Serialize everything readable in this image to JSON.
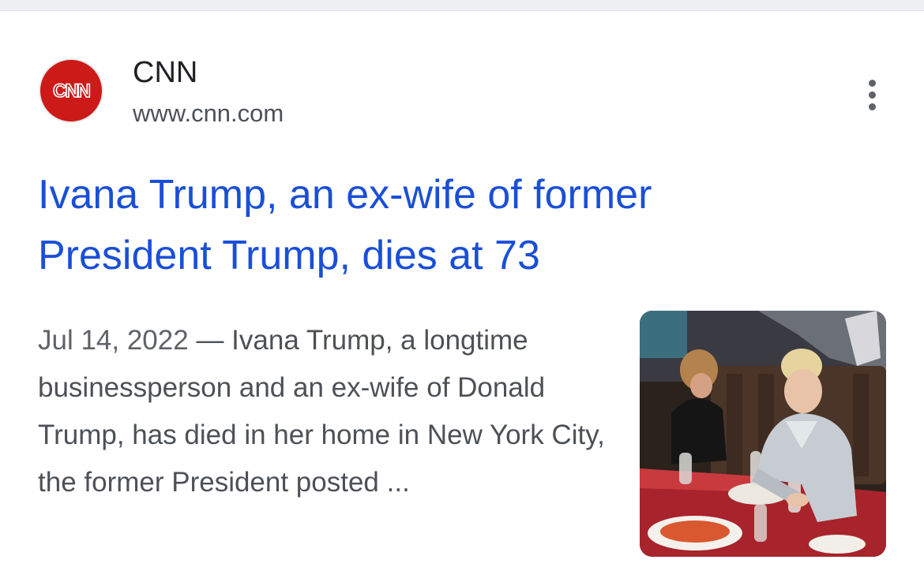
{
  "result": {
    "source": {
      "name": "CNN",
      "url": "www.cnn.com",
      "logo_text": "CNN",
      "logo_color": "#cc1a18"
    },
    "menu_icon": "more-vert-icon",
    "headline": "Ivana Trump, an ex-wife of former President Trump, dies at 73",
    "date": "Jul 14, 2022",
    "separator": " — ",
    "snippet": "Ivana Trump, a longtime businessperson and an ex-wife of Donald Trump, has died in her home in New York City, the former President posted ...",
    "colors": {
      "headline": "#1a4fd6",
      "text": "#4d5156"
    }
  }
}
